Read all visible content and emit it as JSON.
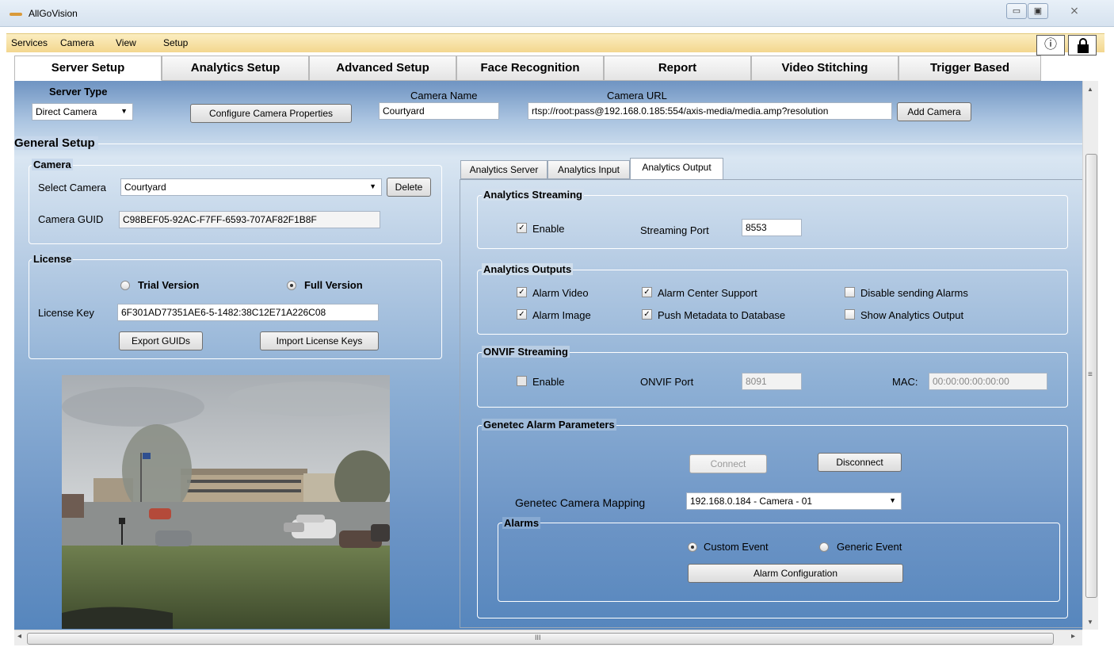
{
  "window": {
    "title": "AllGoVision",
    "minimize": "▭",
    "maximize": "▣",
    "close": "⨯"
  },
  "menu": {
    "items": [
      "Services",
      "Camera",
      "View",
      "Setup"
    ],
    "info_icon": "ⓘ"
  },
  "tabs": [
    "Server Setup",
    "Analytics Setup",
    "Advanced Setup",
    "Face Recognition",
    "Report",
    "Video Stitching",
    "Trigger Based"
  ],
  "server": {
    "type_label": "Server Type",
    "type_value": "Direct Camera",
    "configure_button": "Configure Camera Properties",
    "camera_name_label": "Camera Name",
    "camera_name_value": "Courtyard",
    "camera_url_label": "Camera URL",
    "camera_url_value": "rtsp://root:pass@192.168.0.185:554/axis-media/media.amp?resolution",
    "add_camera_button": "Add Camera"
  },
  "general_setup": {
    "title": "General Setup",
    "camera_group": "Camera",
    "select_camera_label": "Select Camera",
    "select_camera_value": "Courtyard",
    "delete_button": "Delete",
    "guid_label": "Camera GUID",
    "guid_value": "C98BEF05-92AC-F7FF-6593-707AF82F1B8F",
    "license_group": "License",
    "trial_label": "Trial Version",
    "full_label": "Full Version",
    "license_key_label": "License Key",
    "license_key_value": "6F301AD77351AE6-5-1482:38C12E71A226C08",
    "export_button": "Export GUIDs",
    "import_button": "Import License Keys"
  },
  "inner_tabs": [
    "Analytics Server",
    "Analytics Input",
    "Analytics Output"
  ],
  "streaming": {
    "title": "Analytics Streaming",
    "enable_label": "Enable",
    "port_label": "Streaming Port",
    "port_value": "8553"
  },
  "outputs": {
    "title": "Analytics Outputs",
    "alarm_video": "Alarm Video",
    "alarm_image": "Alarm Image",
    "alarm_center": "Alarm Center Support",
    "push_metadata": "Push Metadata to Database",
    "disable_alarms": "Disable sending Alarms",
    "show_output": "Show Analytics Output"
  },
  "onvif": {
    "title": "ONVIF Streaming",
    "enable_label": "Enable",
    "port_label": "ONVIF Port",
    "port_value": "8091",
    "mac_label": "MAC:",
    "mac_value": "00:00:00:00:00:00"
  },
  "genetec": {
    "title": "Genetec Alarm Parameters",
    "connect_button": "Connect",
    "disconnect_button": "Disconnect",
    "mapping_label": "Genetec Camera Mapping",
    "mapping_value": "192.168.0.184 - Camera - 01",
    "alarms_group": "Alarms",
    "custom_event": "Custom Event",
    "generic_event": "Generic Event",
    "alarm_config_button": "Alarm Configuration"
  },
  "scroll": {
    "grip": "≡",
    "h_grip": "III",
    "up": "▲",
    "down": "▼",
    "left": "◂",
    "right": "▸"
  }
}
